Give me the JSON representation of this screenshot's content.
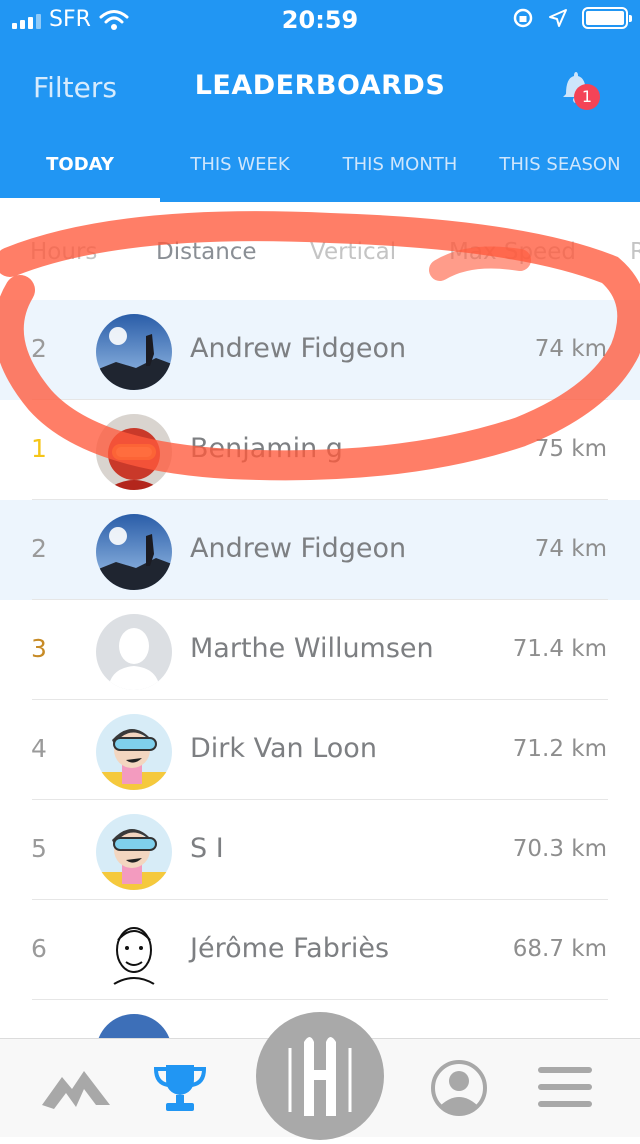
{
  "status_bar": {
    "carrier": "SFR",
    "time": "20:59"
  },
  "nav": {
    "filters_label": "Filters",
    "title": "LEADERBOARDS",
    "notification_count": "1"
  },
  "tabs": [
    {
      "label": "TODAY",
      "active": true
    },
    {
      "label": "THIS WEEK",
      "active": false
    },
    {
      "label": "THIS MONTH",
      "active": false
    },
    {
      "label": "THIS SEASON",
      "active": false
    }
  ],
  "metrics": [
    {
      "label": "Hours",
      "active": false
    },
    {
      "label": "Distance",
      "active": true
    },
    {
      "label": "Vertical",
      "active": false
    },
    {
      "label": "Max Speed",
      "active": false
    },
    {
      "label": "R",
      "active": false
    }
  ],
  "leaderboard": [
    {
      "rank": "2",
      "name": "Andrew Fidgeon",
      "value": "74 km",
      "highlight": true,
      "avatar": "photo-mountain-icon"
    },
    {
      "rank": "1",
      "name": "Benjamin g",
      "value": "75 km",
      "highlight": false,
      "avatar": "photo-goggles-icon"
    },
    {
      "rank": "2",
      "name": "Andrew Fidgeon",
      "value": "74 km",
      "highlight": true,
      "avatar": "photo-mountain-icon"
    },
    {
      "rank": "3",
      "name": "Marthe Willumsen",
      "value": "71.4 km",
      "highlight": false,
      "avatar": "default-avatar-icon"
    },
    {
      "rank": "4",
      "name": "Dirk Van Loon",
      "value": "71.2 km",
      "highlight": false,
      "avatar": "skier-cartoon-icon"
    },
    {
      "rank": "5",
      "name": "S I",
      "value": "70.3 km",
      "highlight": false,
      "avatar": "skier-cartoon-icon"
    },
    {
      "rank": "6",
      "name": "Jérôme Fabriès",
      "value": "68.7 km",
      "highlight": false,
      "avatar": "sketch-portrait-icon"
    }
  ],
  "bottom_nav": [
    {
      "icon": "mountains-icon",
      "active": false
    },
    {
      "icon": "trophy-icon",
      "active": true
    },
    {
      "icon": "skis-icon",
      "active": false
    },
    {
      "icon": "profile-icon",
      "active": false
    },
    {
      "icon": "menu-icon",
      "active": false
    }
  ],
  "colors": {
    "primary": "#2196f3",
    "highlight_row": "#edf5fd",
    "gold": "#f5c518",
    "bronze": "#c78b26",
    "badge": "#f44357",
    "annotation": "#ff5a3c"
  }
}
